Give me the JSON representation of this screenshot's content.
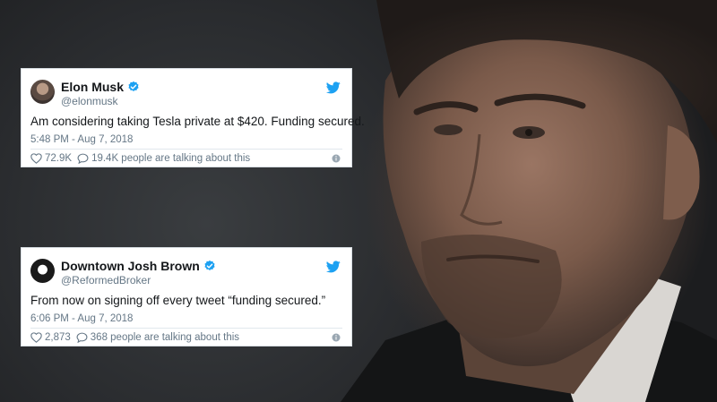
{
  "tweets": [
    {
      "name": "Elon Musk",
      "handle": "@elonmusk",
      "text": "Am considering taking Tesla private at $420. Funding secured.",
      "timestamp": "5:48 PM - Aug 7, 2018",
      "likes": "72.9K",
      "talking": "19.4K people are talking about this"
    },
    {
      "name": "Downtown Josh Brown",
      "handle": "@ReformedBroker",
      "text": "From now on signing off every tweet “funding secured.”",
      "timestamp": "6:06 PM - Aug 7, 2018",
      "likes": "2,873",
      "talking": "368 people are talking about this"
    }
  ],
  "colors": {
    "twitter_blue": "#1da1f2",
    "text_primary": "#14171a",
    "text_secondary": "#657786",
    "card_border": "#d7dde2"
  },
  "icons": {
    "verified": "verified-badge-icon",
    "twitter": "twitter-bird-icon",
    "like": "heart-icon",
    "reply": "speech-bubble-icon",
    "info": "info-icon"
  }
}
